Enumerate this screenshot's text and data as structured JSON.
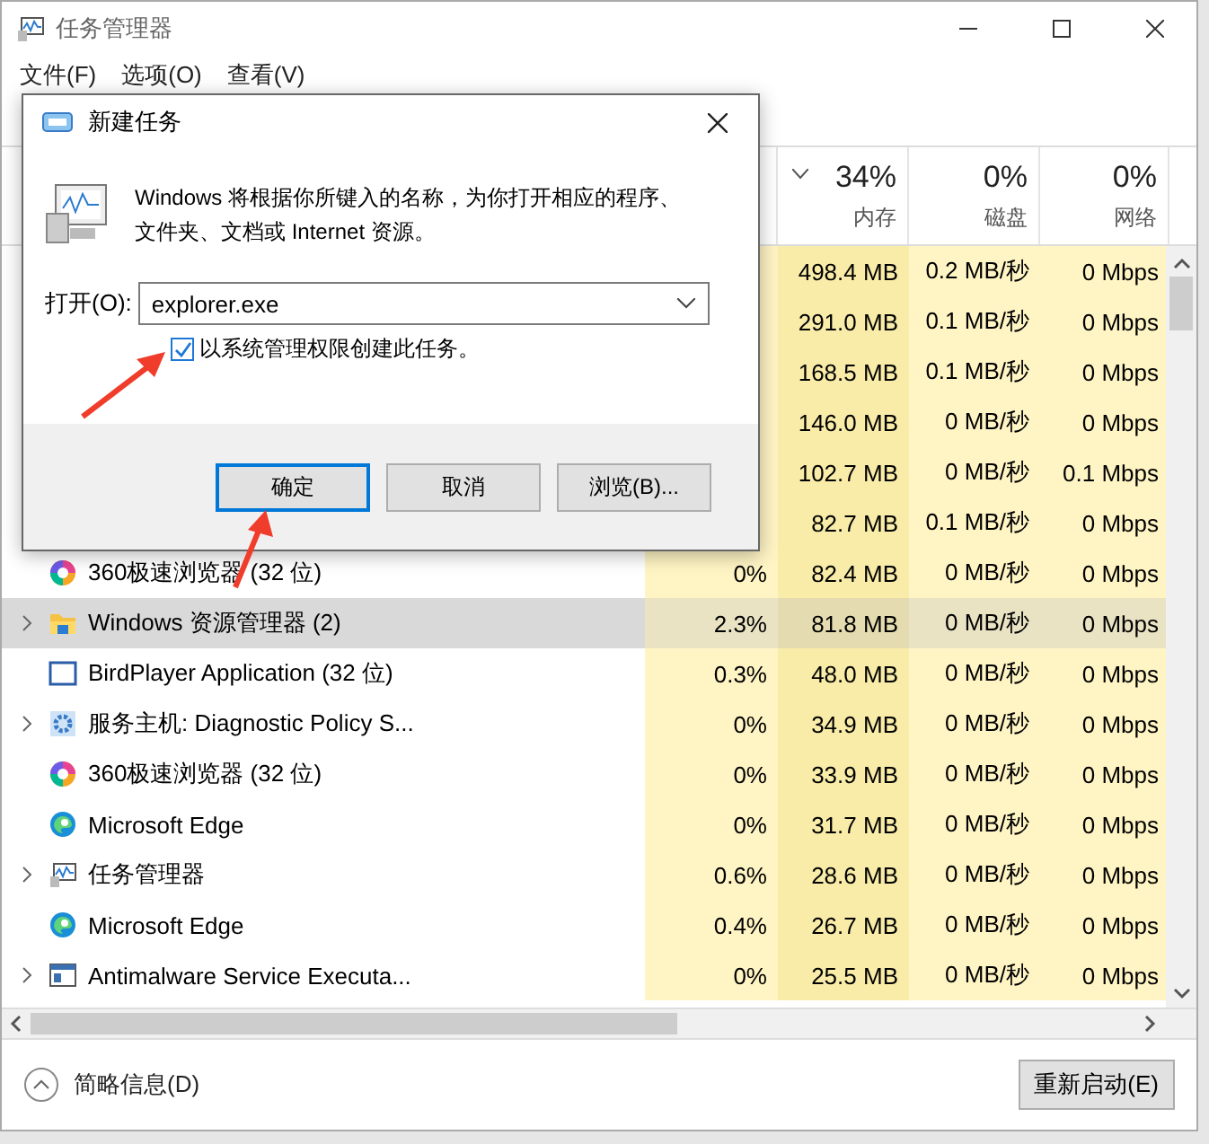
{
  "window": {
    "title": "任务管理器"
  },
  "menu": [
    "文件(F)",
    "选项(O)",
    "查看(V)"
  ],
  "columns": [
    {
      "percent": "34%",
      "label": "内存"
    },
    {
      "percent": "0%",
      "label": "磁盘"
    },
    {
      "percent": "0%",
      "label": "网络"
    }
  ],
  "rows": [
    {
      "memory": "498.4 MB",
      "disk": "0.2 MB/秒",
      "network": "0 Mbps",
      "selected": false
    },
    {
      "memory": "291.0 MB",
      "disk": "0.1 MB/秒",
      "network": "0 Mbps",
      "selected": false
    },
    {
      "memory": "168.5 MB",
      "disk": "0.1 MB/秒",
      "network": "0 Mbps",
      "selected": false
    },
    {
      "memory": "146.0 MB",
      "disk": "0 MB/秒",
      "network": "0 Mbps",
      "selected": false
    },
    {
      "memory": "102.7 MB",
      "disk": "0 MB/秒",
      "network": "0.1 Mbps",
      "selected": false
    },
    {
      "memory": "82.7 MB",
      "disk": "0.1 MB/秒",
      "network": "0 Mbps",
      "selected": false
    },
    {
      "name": "360极速浏览器 (32 位)",
      "kind": "browser",
      "expandable": false,
      "cpu": "0%",
      "memory": "82.4 MB",
      "disk": "0 MB/秒",
      "network": "0 Mbps",
      "selected": false
    },
    {
      "name": "Windows 资源管理器 (2)",
      "kind": "folder",
      "expandable": true,
      "cpu": "2.3%",
      "memory": "81.8 MB",
      "disk": "0 MB/秒",
      "network": "0 Mbps",
      "selected": true
    },
    {
      "name": "BirdPlayer Application (32 位)",
      "kind": "window",
      "expandable": false,
      "cpu": "0.3%",
      "memory": "48.0 MB",
      "disk": "0 MB/秒",
      "network": "0 Mbps",
      "selected": false
    },
    {
      "name": "服务主机: Diagnostic Policy S...",
      "kind": "service",
      "expandable": true,
      "cpu": "0%",
      "memory": "34.9 MB",
      "disk": "0 MB/秒",
      "network": "0 Mbps",
      "selected": false
    },
    {
      "name": "360极速浏览器 (32 位)",
      "kind": "browser",
      "expandable": false,
      "cpu": "0%",
      "memory": "33.9 MB",
      "disk": "0 MB/秒",
      "network": "0 Mbps",
      "selected": false
    },
    {
      "name": "Microsoft Edge",
      "kind": "edge",
      "expandable": false,
      "cpu": "0%",
      "memory": "31.7 MB",
      "disk": "0 MB/秒",
      "network": "0 Mbps",
      "selected": false
    },
    {
      "name": "任务管理器",
      "kind": "monitor",
      "expandable": true,
      "cpu": "0.6%",
      "memory": "28.6 MB",
      "disk": "0 MB/秒",
      "network": "0 Mbps",
      "selected": false
    },
    {
      "name": "Microsoft Edge",
      "kind": "edge",
      "expandable": false,
      "cpu": "0.4%",
      "memory": "26.7 MB",
      "disk": "0 MB/秒",
      "network": "0 Mbps",
      "selected": false
    },
    {
      "name": "Antimalware Service Executa...",
      "kind": "app",
      "expandable": true,
      "cpu": "0%",
      "memory": "25.5 MB",
      "disk": "0 MB/秒",
      "network": "0 Mbps",
      "selected": false
    }
  ],
  "footer": {
    "details_toggle": "简略信息(D)",
    "action_button": "重新启动(E)"
  },
  "dialog": {
    "title": "新建任务",
    "message": "Windows 将根据你所键入的名称，为你打开相应的程序、文件夹、文档或 Internet 资源。",
    "open_label": "打开(O):",
    "open_value": "explorer.exe",
    "admin_checkbox": {
      "label": "以系统管理权限创建此任务。",
      "checked": true
    },
    "buttons": [
      {
        "label": "确定",
        "default": true
      },
      {
        "label": "取消",
        "default": false
      },
      {
        "label": "浏览(B)...",
        "default": false
      }
    ]
  }
}
